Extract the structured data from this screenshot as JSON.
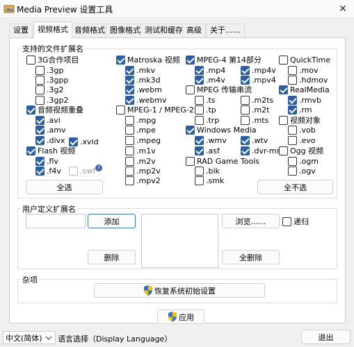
{
  "window": {
    "title": "Media Preview 设置工具",
    "close_glyph": "✕"
  },
  "tabs": [
    "设置",
    "视频格式",
    "音频格式",
    "图像格式",
    "测试和缓存",
    "高级",
    "关于……"
  ],
  "supported": {
    "title": "支持的文件扩展名",
    "col1": [
      {
        "label": "3G合作项目",
        "checked": false
      },
      {
        "label": ".3gp",
        "checked": false
      },
      {
        "label": ".3gpp",
        "checked": false
      },
      {
        "label": ".3g2",
        "checked": false
      },
      {
        "label": ".3gp2",
        "checked": false
      },
      {
        "label": "音频视频重叠",
        "checked": true
      },
      {
        "label": ".avi",
        "checked": true
      },
      {
        "label": ".amv",
        "checked": true
      },
      {
        "label": ".divx",
        "checked": true
      },
      {
        "label": "Flash 视频",
        "checked": true
      },
      {
        "label": ".flv",
        "checked": true
      },
      {
        "label": ".f4v",
        "checked": true
      }
    ],
    "xvid": {
      "label": ".xvid",
      "checked": true
    },
    "swf": {
      "label": ".swf",
      "checked": false
    },
    "help_glyph": "?",
    "col2": [
      {
        "label": "Matroska 视频",
        "checked": true
      },
      {
        "label": ".mkv",
        "checked": true
      },
      {
        "label": ".mk3d",
        "checked": true
      },
      {
        "label": ".webm",
        "checked": true
      },
      {
        "label": ".webmv",
        "checked": true
      },
      {
        "label": "MPEG-1 / MPEG-2",
        "checked": false
      },
      {
        "label": ".mpg",
        "checked": false
      },
      {
        "label": ".mpe",
        "checked": false
      },
      {
        "label": ".mpeg",
        "checked": false
      },
      {
        "label": ".m1v",
        "checked": false
      },
      {
        "label": ".m2v",
        "checked": false
      },
      {
        "label": ".mp2v",
        "checked": false
      },
      {
        "label": ".mpv2",
        "checked": false
      }
    ],
    "col3": [
      {
        "label": "MPEG-4 第14部分",
        "checked": true
      },
      {
        "label": ".mp4",
        "checked": true
      },
      {
        "label": ".m4v",
        "checked": true
      },
      {
        "label": "MPEG 传输串流",
        "checked": false
      },
      {
        "label": ".ts",
        "checked": false
      },
      {
        "label": ".tp",
        "checked": false
      },
      {
        "label": ".trp",
        "checked": false
      },
      {
        "label": "Windows Media",
        "checked": true
      },
      {
        "label": ".wmv",
        "checked": true
      },
      {
        "label": ".asf",
        "checked": true
      },
      {
        "label": "RAD Game Tools",
        "checked": false
      },
      {
        "label": ".bik",
        "checked": false
      },
      {
        "label": ".smk",
        "checked": false
      }
    ],
    "col3b": [
      {
        "label": ".mp4v",
        "checked": true
      },
      {
        "label": ".mpv4",
        "checked": true
      },
      {
        "label": ".m2ts",
        "checked": false
      },
      {
        "label": ".m2t",
        "checked": false
      },
      {
        "label": ".mts",
        "checked": false
      },
      {
        "label": ".wtv",
        "checked": true
      },
      {
        "label": ".dvr-ms",
        "checked": true
      }
    ],
    "col4": [
      {
        "label": "QuickTime",
        "checked": false
      },
      {
        "label": ".mov",
        "checked": false
      },
      {
        "label": ".hdmov",
        "checked": false
      },
      {
        "label": "RealMedia",
        "checked": true
      },
      {
        "label": ".rmvb",
        "checked": true
      },
      {
        "label": ".rm",
        "checked": true
      },
      {
        "label": "视频对象",
        "checked": false
      },
      {
        "label": ".vob",
        "checked": false
      },
      {
        "label": ".evo",
        "checked": false
      },
      {
        "label": "Ogg 视频",
        "checked": false
      },
      {
        "label": ".ogm",
        "checked": false
      },
      {
        "label": ".ogv",
        "checked": false
      }
    ],
    "select_all": "全选",
    "select_none": "全不选"
  },
  "custom": {
    "title": "用户定义扩展名",
    "input_value": "",
    "add": "添加",
    "delete": "删除",
    "browse": "浏览……",
    "recursive": {
      "label": "递归",
      "checked": false
    },
    "delete_all": "全删除"
  },
  "misc": {
    "title": "杂项",
    "restore": "恢复系统初始设置"
  },
  "apply": "应用",
  "footer": {
    "language_value": "中文(简体)",
    "language_label": "语言选择（Display Language）",
    "exit": "退出"
  },
  "colors": {
    "accent": "#2a5fa8",
    "shield_blue": "#2f6fd6",
    "shield_yellow": "#f5c400"
  }
}
